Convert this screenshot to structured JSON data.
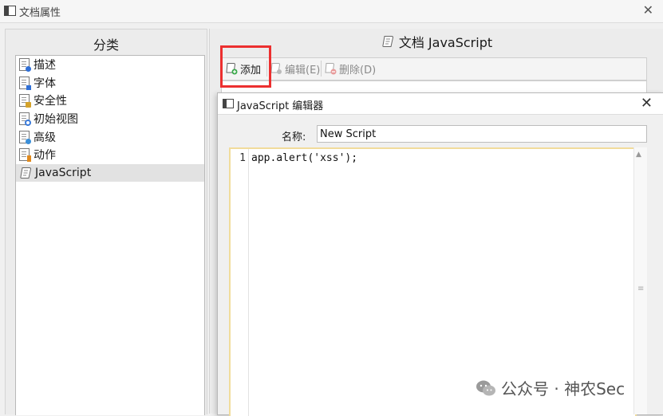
{
  "window": {
    "title": "文档属性",
    "close_glyph": "✕"
  },
  "left": {
    "header": "分类",
    "items": [
      {
        "label": "描述",
        "icon": "doc-info-icon",
        "badge_color": "#2f6fd6"
      },
      {
        "label": "字体",
        "icon": "doc-font-icon",
        "badge_color": "#2f6fd6"
      },
      {
        "label": "安全性",
        "icon": "doc-lock-icon",
        "badge_color": "#d4a22a"
      },
      {
        "label": "初始视图",
        "icon": "doc-view-icon",
        "badge_color": "#3a7ad9"
      },
      {
        "label": "高级",
        "icon": "doc-gear-icon",
        "badge_color": "#3a8fd9"
      },
      {
        "label": "动作",
        "icon": "doc-action-icon",
        "badge_color": "#e08a1e"
      },
      {
        "label": "JavaScript",
        "icon": "script-scroll-icon",
        "selected": true
      }
    ]
  },
  "right": {
    "header": "文档 JavaScript",
    "toolbar": {
      "add": "添加",
      "edit": "编辑(E)",
      "delete": "删除(D)"
    }
  },
  "dialog": {
    "title": "JavaScript 编辑器",
    "close_glyph": "✕",
    "name_label": "名称:",
    "name_value": "New Script",
    "line_number": "1",
    "code": "app.alert('xss');"
  },
  "watermark": "公众号 · 神农Sec",
  "colors": {
    "highlight_red": "#ec2f2f",
    "editor_border": "#f1dc9b"
  }
}
